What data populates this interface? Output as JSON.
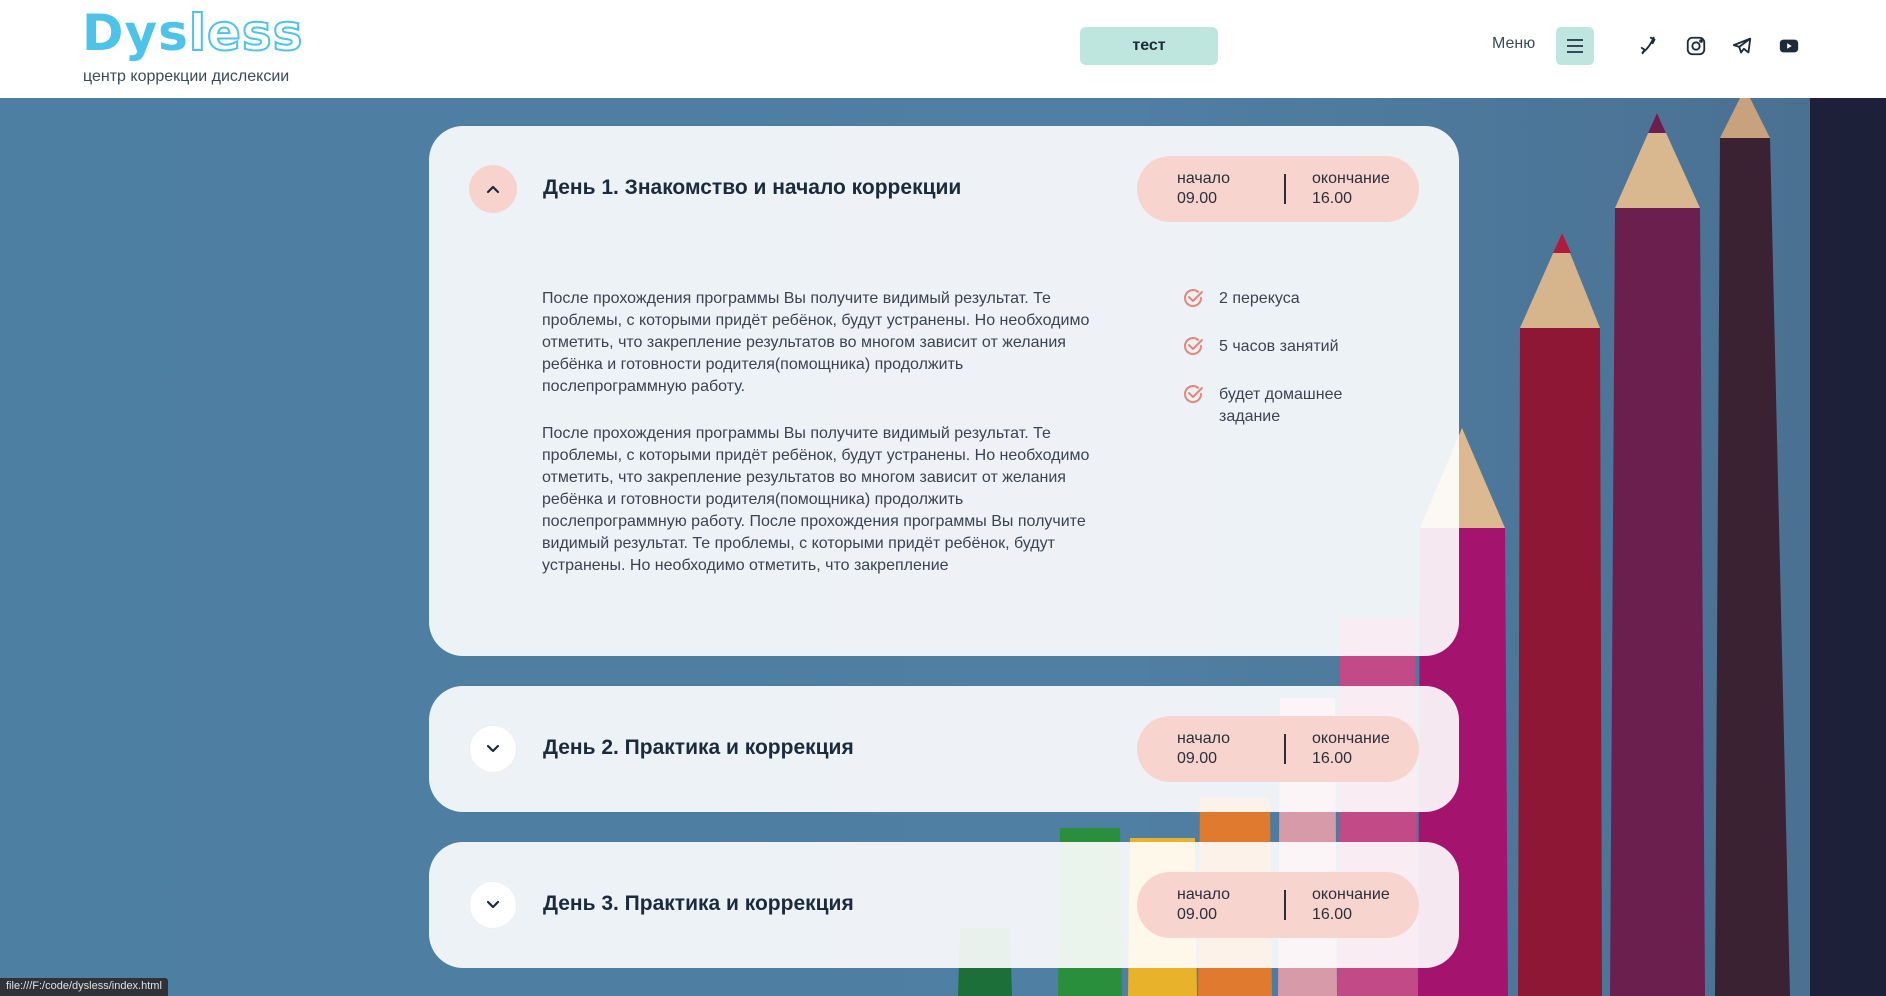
{
  "header": {
    "logo_solid": "Dys",
    "logo_outline": "less",
    "tagline": "центр коррекции дислексии",
    "test_button": "тест",
    "menu_label": "Меню",
    "socials": [
      "phone-icon",
      "instagram-icon",
      "telegram-icon",
      "youtube-icon"
    ]
  },
  "colors": {
    "brand": "#4dc3ea",
    "accent_mint": "#bfe5df",
    "accent_pink": "#f8d4cf",
    "background": "#4d7fa3"
  },
  "days": [
    {
      "title": "День 1. Знакомство и начало коррекции",
      "expanded": true,
      "start_label": "начало",
      "start_time": "09.00",
      "end_label": "окончание",
      "end_time": "16.00",
      "paragraph1": "После прохождения программы Вы получите видимый результат. Те проблемы, с которыми придёт ребёнок, будут устранены. Но необходимо отметить, что закрепление результатов во многом зависит от желания ребёнка и готовности родителя(помощника) продолжить послепрограммную работу.",
      "paragraph2": "После прохождения программы Вы получите видимый результат. Те проблемы, с которыми придёт ребёнок, будут устранены. Но необходимо отметить, что закрепление результатов во многом зависит от желания ребёнка и готовности родителя(помощника) продолжить послепрограммную работу. После прохождения программы Вы получите видимый результат. Те проблемы, с которыми придёт ребёнок, будут устранены. Но необходимо отметить, что закрепление",
      "features": [
        "2 перекуса",
        "5 часов занятий",
        "будет домашнее задание"
      ]
    },
    {
      "title": "День 2. Практика и коррекция",
      "expanded": false,
      "start_label": "начало",
      "start_time": "09.00",
      "end_label": "окончание",
      "end_time": "16.00"
    },
    {
      "title": "День 3. Практика и коррекция",
      "expanded": false,
      "start_label": "начало",
      "start_time": "09.00",
      "end_label": "окончание",
      "end_time": "16.00"
    }
  ],
  "statusbar": {
    "url": "file:///F:/code/dysless/index.html"
  }
}
